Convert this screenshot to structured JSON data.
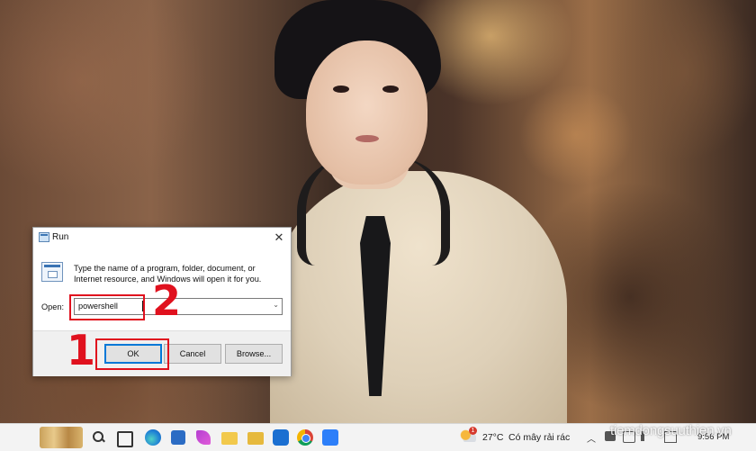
{
  "run_dialog": {
    "title": "Run",
    "description": "Type the name of a program, folder, document, or Internet resource, and Windows will open it for you.",
    "open_label": "Open:",
    "open_value": "powershell",
    "ok_label": "OK",
    "cancel_label": "Cancel",
    "browse_label": "Browse..."
  },
  "annotations": {
    "step_ok": "1",
    "step_input": "2",
    "color": "#e0111e"
  },
  "taskbar": {
    "pinned_icons": [
      "search-icon",
      "task-view-icon",
      "edge-icon",
      "store-icon",
      "feather-app-icon",
      "file-explorer-icon",
      "folder-icon",
      "zalo-icon",
      "chrome-icon",
      "app-icon"
    ],
    "weather": {
      "badge": "1",
      "temperature": "27°C",
      "condition": "Có mây rải rác"
    },
    "clock": "9:56 PM"
  },
  "watermark": "tiemdongsuuthien.vn"
}
